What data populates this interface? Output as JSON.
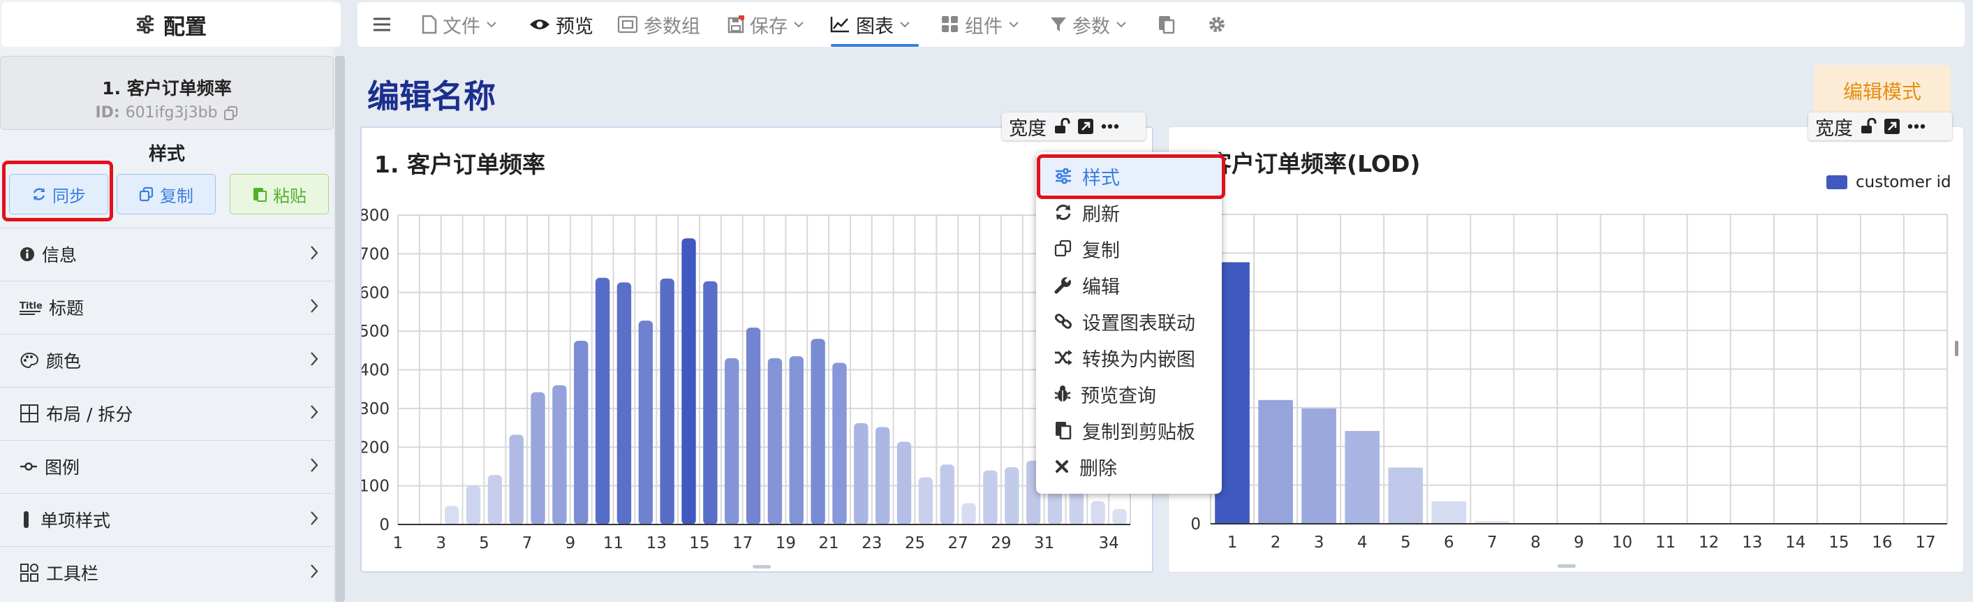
{
  "sidebar": {
    "header_title": "配置",
    "card": {
      "title": "1. 客户订单频率",
      "id_label": "ID:",
      "id_value": "601ifg3j3bb"
    },
    "style_label": "样式",
    "buttons": {
      "sync": "同步",
      "copy": "复制",
      "paste": "粘贴"
    },
    "items": [
      {
        "label": "信息",
        "icon": "info-icon"
      },
      {
        "label": "标题",
        "icon": "title-icon"
      },
      {
        "label": "颜色",
        "icon": "palette-icon"
      },
      {
        "label": "布局 / 拆分",
        "icon": "layout-icon"
      },
      {
        "label": "图例",
        "icon": "legend-icon"
      },
      {
        "label": "单项样式",
        "icon": "bar-style-icon"
      },
      {
        "label": "工具栏",
        "icon": "toolbar-icon"
      }
    ]
  },
  "toolbar": {
    "file": "文件",
    "preview": "预览",
    "param_group": "参数组",
    "save": "保存",
    "chart": "图表",
    "components": "组件",
    "params": "参数"
  },
  "page": {
    "title": "编辑名称",
    "mode_button": "编辑模式"
  },
  "panel_bar": {
    "width_label": "宽度"
  },
  "context_menu": {
    "items": [
      {
        "label": "样式",
        "icon": "sliders-icon"
      },
      {
        "label": "刷新",
        "icon": "refresh-icon"
      },
      {
        "label": "复制",
        "icon": "copy-icon"
      },
      {
        "label": "编辑",
        "icon": "wrench-icon"
      },
      {
        "label": "设置图表联动",
        "icon": "link-icon"
      },
      {
        "label": "转换为内嵌图",
        "icon": "shuffle-icon"
      },
      {
        "label": "预览查询",
        "icon": "bug-icon"
      },
      {
        "label": "复制到剪贴板",
        "icon": "clipboard-icon"
      },
      {
        "label": "删除",
        "icon": "close-icon"
      }
    ]
  },
  "colors": {
    "accent": "#3a7ee0",
    "title": "#1c2f8f",
    "bar_dark": "#4059c0",
    "bar_light": "#e3e7f5",
    "highlight": "#e0111d"
  },
  "chart_data": [
    {
      "type": "bar",
      "title": "1. 客户订单频率",
      "x_tick_labels": [
        "1",
        "3",
        "5",
        "7",
        "9",
        "11",
        "13",
        "15",
        "17",
        "19",
        "21",
        "23",
        "25",
        "27",
        "29",
        "31",
        "34"
      ],
      "x": [
        1,
        2,
        3,
        4,
        5,
        6,
        7,
        8,
        9,
        10,
        11,
        12,
        13,
        14,
        15,
        16,
        17,
        18,
        19,
        20,
        21,
        22,
        23,
        24,
        25,
        26,
        27,
        28,
        29,
        30,
        31,
        32,
        33,
        34
      ],
      "values": [
        2,
        3,
        48,
        100,
        128,
        232,
        342,
        360,
        475,
        638,
        626,
        527,
        636,
        740,
        629,
        430,
        509,
        430,
        435,
        480,
        418,
        262,
        252,
        214,
        122,
        155,
        55,
        140,
        148,
        165,
        130,
        110,
        60,
        40
      ],
      "ylim": [
        0,
        800
      ],
      "yticks": [
        0,
        100,
        200,
        300,
        400,
        500,
        600,
        700,
        800
      ],
      "grid": true
    },
    {
      "type": "bar",
      "title": "客户订单频率(LOD)",
      "x": [
        1,
        2,
        3,
        4,
        5,
        6,
        7,
        8,
        9,
        10,
        11,
        12,
        13,
        14,
        15,
        16,
        17
      ],
      "values": [
        0.93,
        0.44,
        0.41,
        0.33,
        0.2,
        0.08,
        0.01,
        0,
        0,
        0,
        0,
        0,
        0,
        0,
        0,
        0,
        0
      ],
      "ylim": [
        0,
        1.1
      ],
      "y_tick_labels": [
        "0"
      ],
      "legend": [
        "customer id"
      ],
      "legend_position": "top-right",
      "grid": true
    }
  ]
}
